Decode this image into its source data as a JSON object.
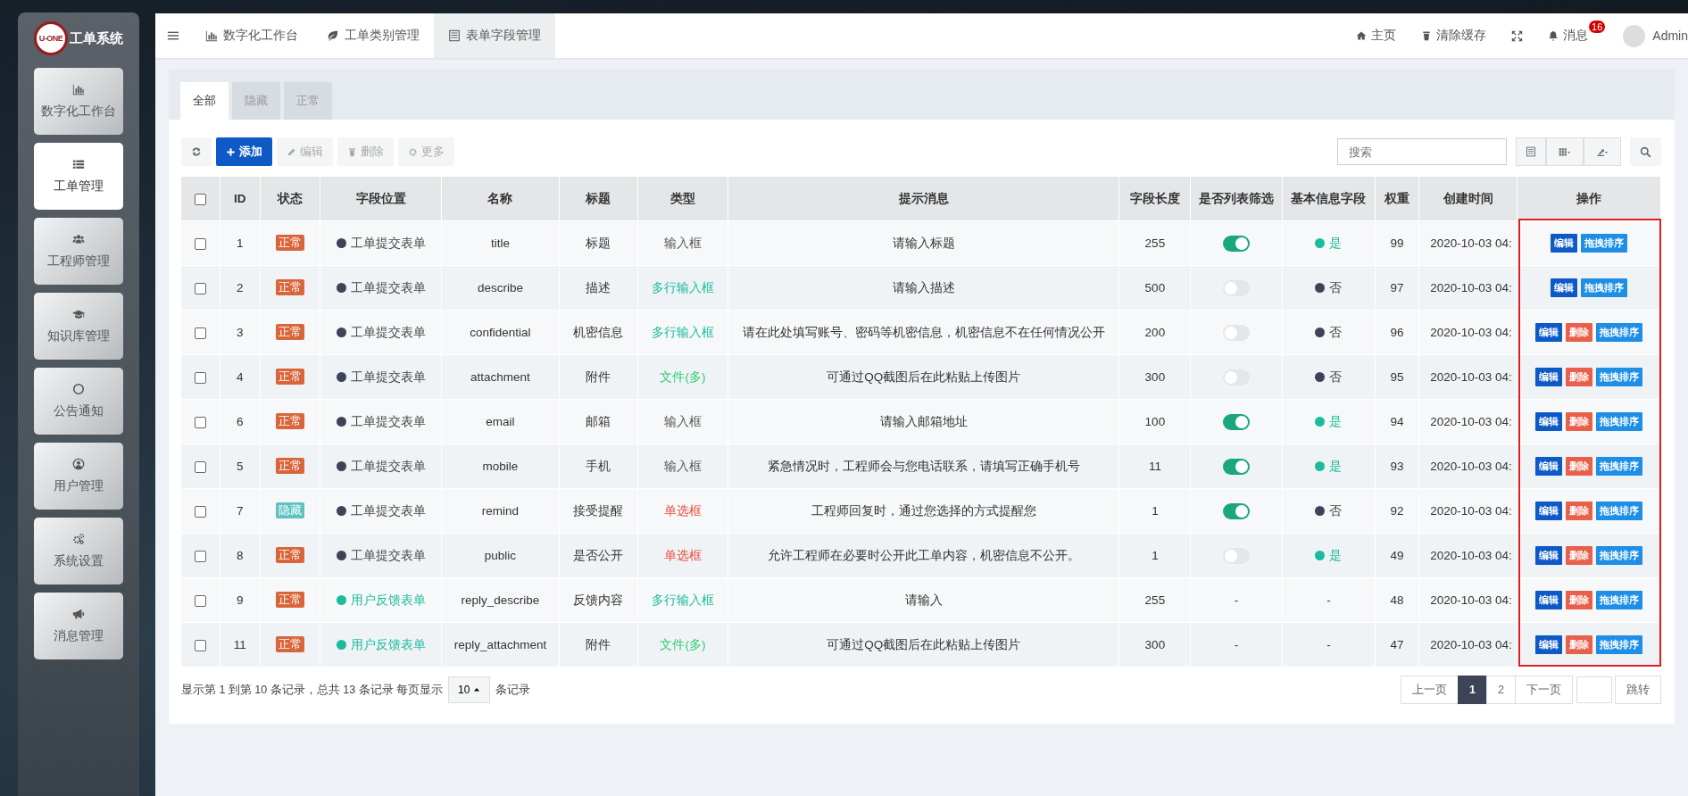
{
  "sidebar": {
    "logo_text": "U-ONE",
    "title": "工单系统",
    "items": [
      {
        "label": "数字化工作台",
        "selected": false
      },
      {
        "label": "工单管理",
        "selected": true
      },
      {
        "label": "工程师管理",
        "selected": false
      },
      {
        "label": "知识库管理",
        "selected": false
      },
      {
        "label": "公告通知",
        "selected": false
      },
      {
        "label": "用户管理",
        "selected": false
      },
      {
        "label": "系统设置",
        "selected": false
      },
      {
        "label": "消息管理",
        "selected": false
      }
    ]
  },
  "topbar": {
    "tabs": [
      {
        "label": "数字化工作台",
        "selected": false
      },
      {
        "label": "工单类别管理",
        "selected": false
      },
      {
        "label": "表单字段管理",
        "selected": true
      }
    ],
    "home": "主页",
    "clear_cache": "清除缓存",
    "messages": "消息",
    "message_badge": "16",
    "user": "Admin"
  },
  "filter_tabs": [
    {
      "label": "全部",
      "selected": true
    },
    {
      "label": "隐藏",
      "selected": false
    },
    {
      "label": "正常",
      "selected": false
    }
  ],
  "toolbar": {
    "add": "添加",
    "edit": {
      "label": "编辑",
      "disabled": true
    },
    "delete": {
      "label": "删除",
      "disabled": true
    },
    "more": "更多",
    "search_placeholder": "搜索"
  },
  "table": {
    "select_all": {
      "checked": false
    },
    "columns": [
      "ID",
      "状态",
      "字段位置",
      "名称",
      "标题",
      "类型",
      "提示消息",
      "字段长度",
      "是否列表筛选",
      "基本信息字段",
      "权重",
      "创建时间",
      "操作"
    ],
    "rows": [
      {
        "checked": false,
        "id": "1",
        "status": {
          "kind": "normal",
          "label": "正常"
        },
        "location": {
          "label": "工单提交表单",
          "color": "#3d4457"
        },
        "name": "title",
        "title": "标题",
        "type": {
          "label": "输入框",
          "color": "#555555"
        },
        "hint": "请输入标题",
        "length": "255",
        "list_filter": {
          "on": true
        },
        "basic_info": {
          "label": "是",
          "color": "#1abc9c"
        },
        "weight": "99",
        "created": "2020-10-03 04:",
        "actions": [
          {
            "kind": "edit",
            "label": "编辑"
          },
          {
            "kind": "sort",
            "label": "拖拽排序"
          }
        ]
      },
      {
        "checked": false,
        "id": "2",
        "status": {
          "kind": "normal",
          "label": "正常"
        },
        "location": {
          "label": "工单提交表单",
          "color": "#3d4457"
        },
        "name": "describe",
        "title": "描述",
        "type": {
          "label": "多行输入框",
          "color": "#1abc9c"
        },
        "hint": "请输入描述",
        "length": "500",
        "list_filter": {
          "on": false
        },
        "basic_info": {
          "label": "否",
          "color": "#3d4457"
        },
        "weight": "97",
        "created": "2020-10-03 04:",
        "actions": [
          {
            "kind": "edit",
            "label": "编辑"
          },
          {
            "kind": "sort",
            "label": "拖拽排序"
          }
        ]
      },
      {
        "checked": false,
        "id": "3",
        "status": {
          "kind": "normal",
          "label": "正常"
        },
        "location": {
          "label": "工单提交表单",
          "color": "#3d4457"
        },
        "name": "confidential",
        "title": "机密信息",
        "type": {
          "label": "多行输入框",
          "color": "#1abc9c"
        },
        "hint": "请在此处填写账号、密码等机密信息，机密信息不在任何情况公开",
        "length": "200",
        "list_filter": {
          "on": false
        },
        "basic_info": {
          "label": "否",
          "color": "#3d4457"
        },
        "weight": "96",
        "created": "2020-10-03 04:",
        "actions": [
          {
            "kind": "edit",
            "label": "编辑"
          },
          {
            "kind": "delete",
            "label": "删除"
          },
          {
            "kind": "sort",
            "label": "拖拽排序"
          }
        ]
      },
      {
        "checked": false,
        "id": "4",
        "status": {
          "kind": "normal",
          "label": "正常"
        },
        "location": {
          "label": "工单提交表单",
          "color": "#3d4457"
        },
        "name": "attachment",
        "title": "附件",
        "type": {
          "label": "文件(多)",
          "color": "#2ecc71"
        },
        "hint": "可通过QQ截图后在此粘贴上传图片",
        "length": "300",
        "list_filter": {
          "on": false
        },
        "basic_info": {
          "label": "否",
          "color": "#3d4457"
        },
        "weight": "95",
        "created": "2020-10-03 04:",
        "actions": [
          {
            "kind": "edit",
            "label": "编辑"
          },
          {
            "kind": "delete",
            "label": "删除"
          },
          {
            "kind": "sort",
            "label": "拖拽排序"
          }
        ]
      },
      {
        "checked": false,
        "id": "6",
        "status": {
          "kind": "normal",
          "label": "正常"
        },
        "location": {
          "label": "工单提交表单",
          "color": "#3d4457"
        },
        "name": "email",
        "title": "邮箱",
        "type": {
          "label": "输入框",
          "color": "#555555"
        },
        "hint": "请输入邮箱地址",
        "length": "100",
        "list_filter": {
          "on": true
        },
        "basic_info": {
          "label": "是",
          "color": "#1abc9c"
        },
        "weight": "94",
        "created": "2020-10-03 04:",
        "actions": [
          {
            "kind": "edit",
            "label": "编辑"
          },
          {
            "kind": "delete",
            "label": "删除"
          },
          {
            "kind": "sort",
            "label": "拖拽排序"
          }
        ]
      },
      {
        "checked": false,
        "id": "5",
        "status": {
          "kind": "normal",
          "label": "正常"
        },
        "location": {
          "label": "工单提交表单",
          "color": "#3d4457"
        },
        "name": "mobile",
        "title": "手机",
        "type": {
          "label": "输入框",
          "color": "#555555"
        },
        "hint": "紧急情况时，工程师会与您电话联系，请填写正确手机号",
        "length": "11",
        "list_filter": {
          "on": true
        },
        "basic_info": {
          "label": "是",
          "color": "#1abc9c"
        },
        "weight": "93",
        "created": "2020-10-03 04:",
        "actions": [
          {
            "kind": "edit",
            "label": "编辑"
          },
          {
            "kind": "delete",
            "label": "删除"
          },
          {
            "kind": "sort",
            "label": "拖拽排序"
          }
        ]
      },
      {
        "checked": false,
        "id": "7",
        "status": {
          "kind": "hidden",
          "label": "隐藏"
        },
        "location": {
          "label": "工单提交表单",
          "color": "#3d4457"
        },
        "name": "remind",
        "title": "接受提醒",
        "type": {
          "label": "单选框",
          "color": "#e74c3c"
        },
        "hint": "工程师回复时，通过您选择的方式提醒您",
        "length": "1",
        "list_filter": {
          "on": true
        },
        "basic_info": {
          "label": "否",
          "color": "#3d4457"
        },
        "weight": "92",
        "created": "2020-10-03 04:",
        "actions": [
          {
            "kind": "edit",
            "label": "编辑"
          },
          {
            "kind": "delete",
            "label": "删除"
          },
          {
            "kind": "sort",
            "label": "拖拽排序"
          }
        ]
      },
      {
        "checked": false,
        "id": "8",
        "status": {
          "kind": "normal",
          "label": "正常"
        },
        "location": {
          "label": "工单提交表单",
          "color": "#3d4457"
        },
        "name": "public",
        "title": "是否公开",
        "type": {
          "label": "单选框",
          "color": "#e74c3c"
        },
        "hint": "允许工程师在必要时公开此工单内容，机密信息不公开。",
        "length": "1",
        "list_filter": {
          "on": false
        },
        "basic_info": {
          "label": "是",
          "color": "#1abc9c"
        },
        "weight": "49",
        "created": "2020-10-03 04:",
        "actions": [
          {
            "kind": "edit",
            "label": "编辑"
          },
          {
            "kind": "delete",
            "label": "删除"
          },
          {
            "kind": "sort",
            "label": "拖拽排序"
          }
        ]
      },
      {
        "checked": false,
        "id": "9",
        "status": {
          "kind": "normal",
          "label": "正常"
        },
        "location": {
          "label": "用户反馈表单",
          "color": "#1abc9c"
        },
        "name": "reply_describe",
        "title": "反馈内容",
        "type": {
          "label": "多行输入框",
          "color": "#1abc9c"
        },
        "hint": "请输入",
        "length": "255",
        "list_filter": {
          "text": "-"
        },
        "basic_info": {
          "label": "-"
        },
        "weight": "48",
        "created": "2020-10-03 04:",
        "actions": [
          {
            "kind": "edit",
            "label": "编辑"
          },
          {
            "kind": "delete",
            "label": "删除"
          },
          {
            "kind": "sort",
            "label": "拖拽排序"
          }
        ]
      },
      {
        "checked": false,
        "id": "11",
        "status": {
          "kind": "normal",
          "label": "正常"
        },
        "location": {
          "label": "用户反馈表单",
          "color": "#1abc9c"
        },
        "name": "reply_attachment",
        "title": "附件",
        "type": {
          "label": "文件(多)",
          "color": "#2ecc71"
        },
        "hint": "可通过QQ截图后在此粘贴上传图片",
        "length": "300",
        "list_filter": {
          "text": "-"
        },
        "basic_info": {
          "label": "-"
        },
        "weight": "47",
        "created": "2020-10-03 04:",
        "actions": [
          {
            "kind": "edit",
            "label": "编辑"
          },
          {
            "kind": "delete",
            "label": "删除"
          },
          {
            "kind": "sort",
            "label": "拖拽排序"
          }
        ]
      }
    ]
  },
  "footer": {
    "summary": "显示第 1 到第 10 条记录，总共 13 条记录 每页显示",
    "page_size": "10",
    "summary_end": "条记录",
    "pages": [
      {
        "label": "上一页",
        "selected": false
      },
      {
        "label": "1",
        "selected": true
      },
      {
        "label": "2",
        "selected": false
      },
      {
        "label": "下一页",
        "selected": false
      }
    ],
    "jump": "跳转"
  }
}
